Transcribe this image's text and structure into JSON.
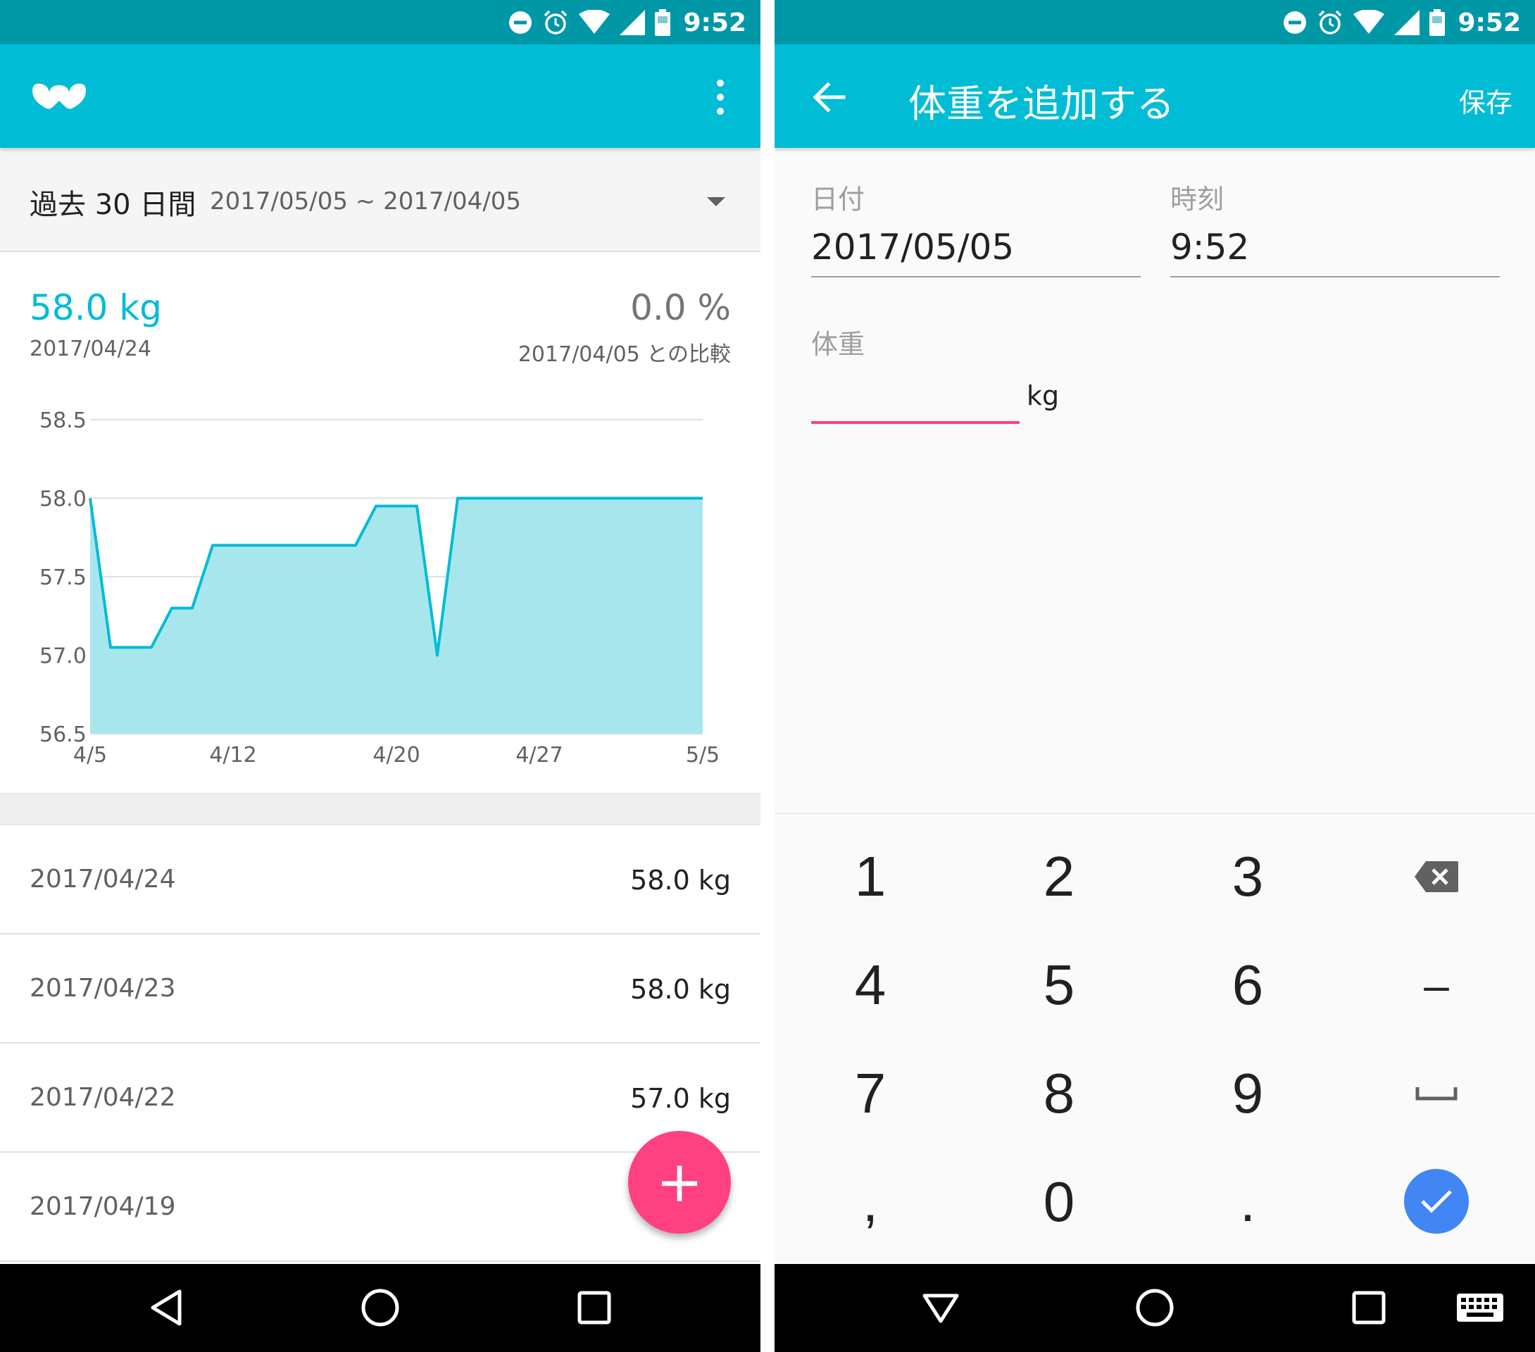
{
  "status_bar": {
    "time": "9:52"
  },
  "left": {
    "period": {
      "label": "過去 30 日間",
      "range": "2017/05/05 ~ 2017/04/05"
    },
    "summary": {
      "weight": "58.0 kg",
      "date": "2017/04/24",
      "percent": "0.0 %",
      "compare": "2017/04/05 との比較"
    },
    "records": [
      {
        "date": "2017/04/24",
        "weight": "58.0 kg"
      },
      {
        "date": "2017/04/23",
        "weight": "58.0 kg"
      },
      {
        "date": "2017/04/22",
        "weight": "57.0 kg"
      },
      {
        "date": "2017/04/19",
        "weight": ""
      }
    ],
    "fab_label": "+"
  },
  "right": {
    "title": "体重を追加する",
    "save_label": "保存",
    "date_label": "日付",
    "date_value": "2017/05/05",
    "time_label": "時刻",
    "time_value": "9:52",
    "weight_label": "体重",
    "weight_value": "",
    "unit": "kg",
    "keypad": {
      "keys": [
        "1",
        "2",
        "3",
        "4",
        "5",
        "6",
        "–",
        "7",
        "8",
        "9",
        ",",
        "0",
        "."
      ]
    }
  },
  "colors": {
    "primary": "#00bcd4",
    "primary_dark": "#0097a7",
    "accent": "#ff4081",
    "chart_fill": "#a8e6ee",
    "done_button": "#4285f4"
  },
  "chart_data": {
    "type": "area",
    "x": [
      "4/5",
      "4/6",
      "4/7",
      "4/8",
      "4/9",
      "4/10",
      "4/11",
      "4/12",
      "4/13",
      "4/14",
      "4/15",
      "4/16",
      "4/17",
      "4/18",
      "4/19",
      "4/20",
      "4/21",
      "4/22",
      "4/23",
      "4/24",
      "5/5"
    ],
    "series": [
      {
        "values": [
          58.0,
          57.05,
          57.05,
          57.05,
          57.3,
          57.3,
          57.7,
          57.7,
          57.7,
          57.7,
          57.7,
          57.7,
          57.7,
          57.7,
          57.95,
          57.95,
          57.95,
          57.0,
          58.0,
          58.0,
          58.0
        ]
      }
    ],
    "x_ticks": [
      "4/5",
      "4/12",
      "4/20",
      "4/27",
      "5/5"
    ],
    "y_ticks": [
      "58.5",
      "58.0",
      "57.5",
      "57.0",
      "56.5"
    ],
    "ylim": [
      56.5,
      58.5
    ],
    "grid": true,
    "xlabel": "",
    "ylabel": ""
  }
}
